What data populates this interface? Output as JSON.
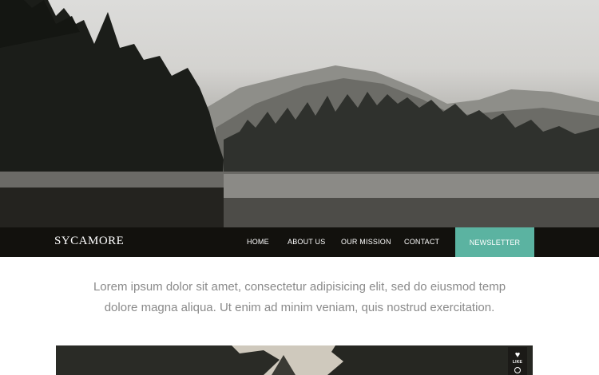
{
  "hero": {
    "image": "misty-lake-forest-photo"
  },
  "navbar": {
    "brand": "SYCAMORE",
    "items": [
      {
        "label": "HOME"
      },
      {
        "label": "ABOUT US"
      },
      {
        "label": "OUR MISSION"
      },
      {
        "label": "CONTACT"
      }
    ],
    "cta": "NEWSLETTER"
  },
  "intro": {
    "line1": "Lorem ipsum dolor sit amet, consectetur adipisicing elit, sed do eiusmod temp",
    "line2": "dolore magna aliqua. Ut enim ad minim veniam, quis nostrud exercitation."
  },
  "gallery": {
    "image": "forest-trees-photo",
    "like": {
      "icon": "heart-icon",
      "label": "LIKE"
    }
  },
  "colors": {
    "nav_background": "#12110d",
    "accent": "#5bb3a1",
    "intro_text": "#8a8a8a"
  }
}
